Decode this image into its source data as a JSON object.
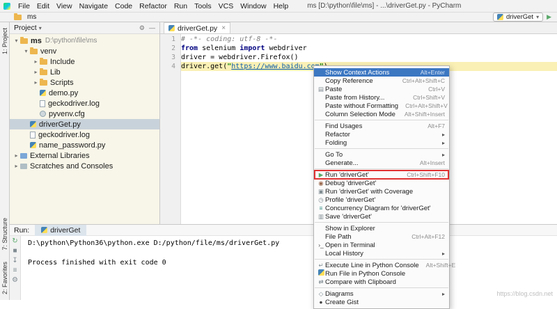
{
  "window": {
    "title": "ms [D:\\python\\file\\ms] - ...\\driverGet.py - PyCharm"
  },
  "menubar": {
    "items": [
      "File",
      "Edit",
      "View",
      "Navigate",
      "Code",
      "Refactor",
      "Run",
      "Tools",
      "VCS",
      "Window",
      "Help"
    ]
  },
  "toolbar": {
    "breadcrumb": "ms",
    "run_config": "driverGet"
  },
  "left_strip": {
    "top": [
      {
        "label": "1: Project"
      }
    ],
    "bottom": [
      {
        "label": "7: Structure"
      },
      {
        "label": "2: Favorites"
      }
    ]
  },
  "project_panel": {
    "title": "Project",
    "tree": [
      {
        "label": "ms",
        "path": "D:\\python\\file\\ms",
        "level": 0,
        "icon": "folder-icon",
        "arrow": "expanded",
        "bold": true
      },
      {
        "label": "venv",
        "level": 1,
        "icon": "folder-icon",
        "arrow": "expanded"
      },
      {
        "label": "Include",
        "level": 2,
        "icon": "folder-icon",
        "arrow": "collapsed"
      },
      {
        "label": "Lib",
        "level": 2,
        "icon": "folder-icon",
        "arrow": "collapsed"
      },
      {
        "label": "Scripts",
        "level": 2,
        "icon": "folder-icon",
        "arrow": "collapsed"
      },
      {
        "label": "demo.py",
        "level": 2,
        "icon": "python-icon"
      },
      {
        "label": "geckodriver.log",
        "level": 2,
        "icon": "file-icon"
      },
      {
        "label": "pyvenv.cfg",
        "level": 2,
        "icon": "config-icon"
      },
      {
        "label": "driverGet.py",
        "level": 1,
        "icon": "python-icon",
        "selected": true
      },
      {
        "label": "geckodriver.log",
        "level": 1,
        "icon": "file-icon"
      },
      {
        "label": "name_password.py",
        "level": 1,
        "icon": "python-icon"
      },
      {
        "label": "External Libraries",
        "level": 0,
        "icon": "library-icon",
        "arrow": "collapsed"
      },
      {
        "label": "Scratches and Consoles",
        "level": 0,
        "icon": "scratch-icon",
        "arrow": "collapsed"
      }
    ]
  },
  "editor": {
    "tab": {
      "label": "driverGet.py"
    },
    "lines": [
      {
        "no": "1",
        "segments": [
          {
            "t": "# -*- coding: utf-8 -*-",
            "c": "comment"
          }
        ]
      },
      {
        "no": "2",
        "segments": [
          {
            "t": "from ",
            "c": "kw"
          },
          {
            "t": "selenium ",
            "c": "plain"
          },
          {
            "t": "import ",
            "c": "kw"
          },
          {
            "t": "webdriver",
            "c": "plain"
          }
        ]
      },
      {
        "no": "3",
        "segments": [
          {
            "t": "driver = webdriver.Firefox()",
            "c": "plain"
          }
        ]
      },
      {
        "no": "4",
        "highlight": true,
        "segments": [
          {
            "t": "driver.get(",
            "c": "plain"
          },
          {
            "t": "\"",
            "c": "str"
          },
          {
            "t": "https://www.baidu.com",
            "c": "link"
          },
          {
            "t": "\"",
            "c": "str"
          },
          {
            "t": ")",
            "c": "plain"
          }
        ]
      }
    ]
  },
  "context_menu": {
    "items": [
      {
        "label": "Show Context Actions",
        "shortcut": "Alt+Enter",
        "selected": true
      },
      {
        "label": "Copy Reference",
        "shortcut": "Ctrl+Alt+Shift+C"
      },
      {
        "label": "Paste",
        "shortcut": "Ctrl+V",
        "icon": "paste-icon"
      },
      {
        "label": "Paste from History...",
        "shortcut": "Ctrl+Shift+V"
      },
      {
        "label": "Paste without Formatting",
        "shortcut": "Ctrl+Alt+Shift+V"
      },
      {
        "label": "Column Selection Mode",
        "shortcut": "Alt+Shift+Insert"
      },
      {
        "separator": true
      },
      {
        "label": "Find Usages",
        "shortcut": "Alt+F7"
      },
      {
        "label": "Refactor",
        "submenu": true
      },
      {
        "label": "Folding",
        "submenu": true
      },
      {
        "separator": true
      },
      {
        "label": "Go To",
        "submenu": true
      },
      {
        "label": "Generate...",
        "shortcut": "Alt+Insert"
      },
      {
        "separator": true
      },
      {
        "label": "Run 'driverGet'",
        "shortcut": "Ctrl+Shift+F10",
        "icon": "run-icon",
        "annotated": true
      },
      {
        "label": "Debug 'driverGet'",
        "icon": "debug-icon"
      },
      {
        "label": "Run 'driverGet' with Coverage",
        "icon": "coverage-icon"
      },
      {
        "label": "Profile 'driverGet'",
        "icon": "profile-icon"
      },
      {
        "label": "Concurrency Diagram for 'driverGet'",
        "icon": "concurrency-icon"
      },
      {
        "label": "Save 'driverGet'",
        "icon": "save-icon"
      },
      {
        "separator": true
      },
      {
        "label": "Show in Explorer"
      },
      {
        "label": "File Path",
        "shortcut": "Ctrl+Alt+F12"
      },
      {
        "label": "Open in Terminal",
        "icon": "terminal-icon"
      },
      {
        "label": "Local History",
        "submenu": true
      },
      {
        "separator": true
      },
      {
        "label": "Execute Line in Python Console",
        "shortcut": "Alt+Shift+E",
        "icon": "enter-icon"
      },
      {
        "label": "Run File in Python Console",
        "icon": "python-icon"
      },
      {
        "label": "Compare with Clipboard",
        "icon": "compare-icon"
      },
      {
        "separator": true
      },
      {
        "label": "Diagrams",
        "submenu": true,
        "icon": "diagram-icon"
      },
      {
        "label": "Create Gist",
        "icon": "gist-icon"
      }
    ]
  },
  "run_panel": {
    "label": "Run:",
    "tab": "driverGet",
    "toolbar_icons": [
      "rerun-icon",
      "stop-icon",
      "scroll-icon",
      "menu-icon",
      "settings-icon"
    ],
    "console": [
      "D:\\python\\Python36\\python.exe D:/python/file/ms/driverGet.py",
      "",
      "Process finished with exit code 0"
    ]
  },
  "watermark": "https://blog.csdn.net"
}
